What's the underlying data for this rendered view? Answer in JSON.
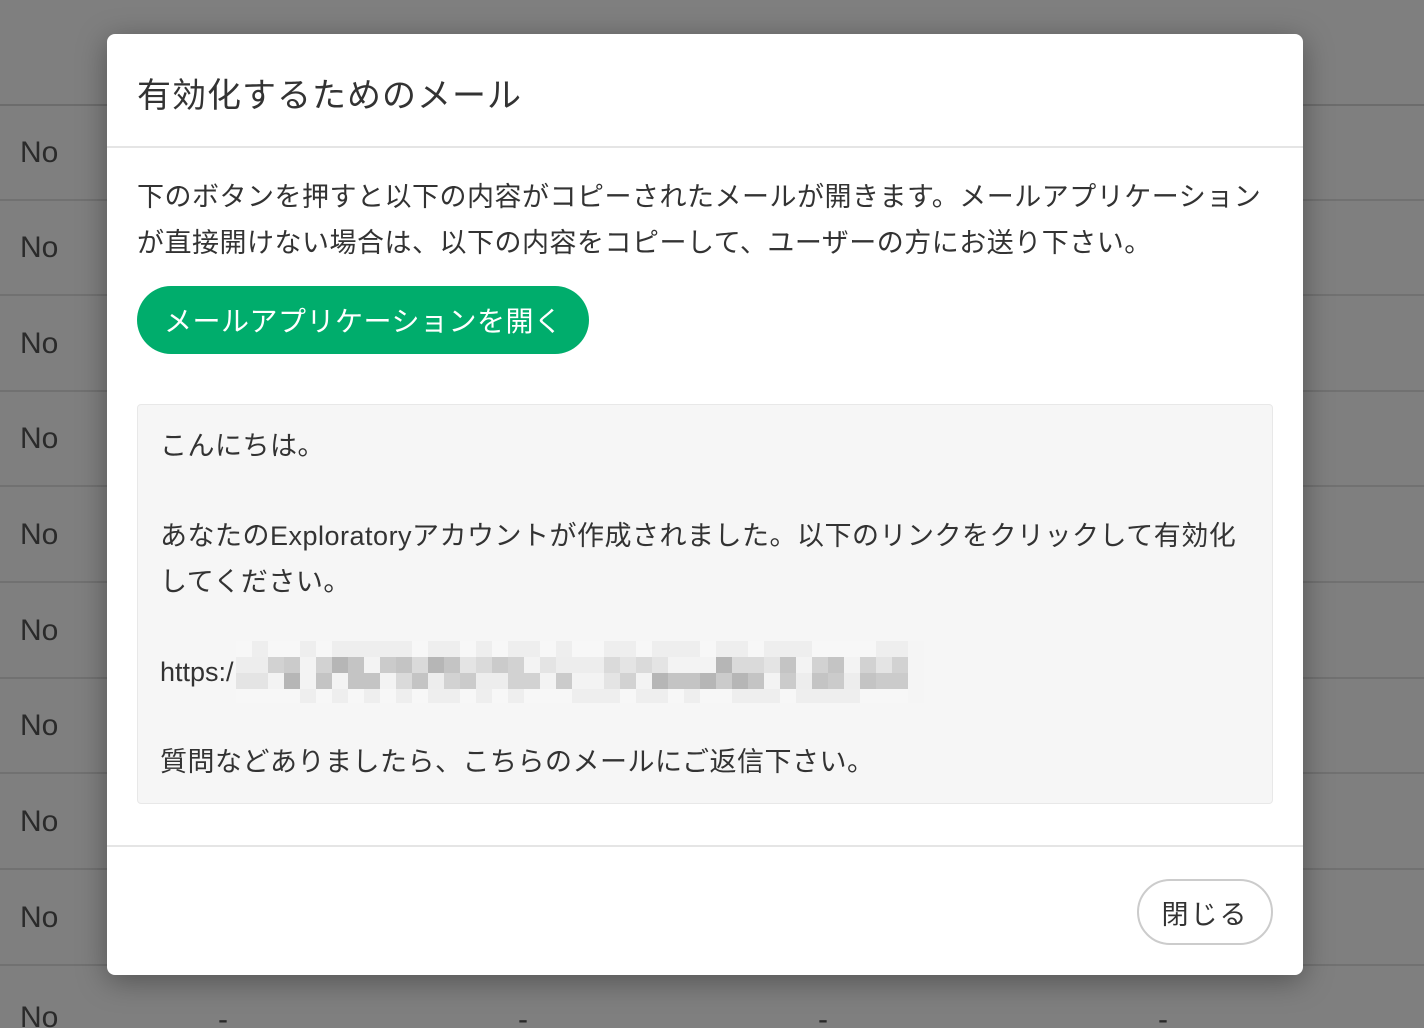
{
  "background": {
    "rows": [
      "No",
      "No",
      "No",
      "No",
      "No",
      "No",
      "No",
      "No",
      "No",
      "No"
    ],
    "last_row_dashes": [
      "-",
      "-",
      "-",
      "-"
    ]
  },
  "modal": {
    "title": "有効化するためのメール",
    "description": "下のボタンを押すと以下の内容がコピーされたメールが開きます。メールアプリケーションが直接開けない場合は、以下の内容をコピーして、ユーザーの方にお送り下さい。",
    "open_mail_button_label": "メールアプリケーションを開く",
    "mail": {
      "greeting": "こんにちは。",
      "body": "あなたのExploratoryアカウントが作成されました。以下のリンクをクリックして有効化してください。",
      "url_prefix": "https:/",
      "closing": "質問などありましたら、こちらのメールにご返信下さい。"
    },
    "close_button_label": "閉じる"
  },
  "colors": {
    "primary_button": "#00ad6c",
    "overlay": "rgba(0,0,0,0.5)"
  }
}
